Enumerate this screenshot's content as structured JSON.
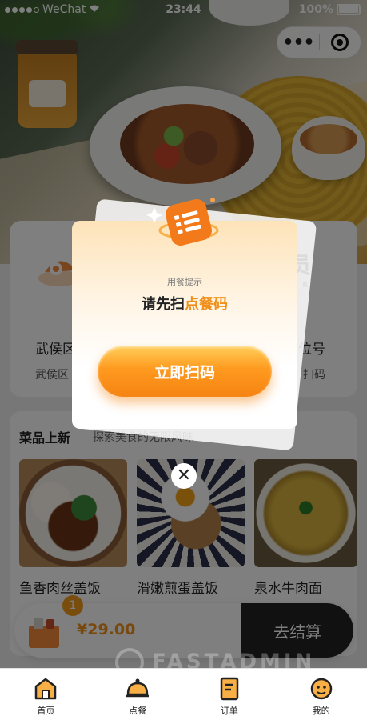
{
  "status_bar": {
    "carrier": "WeChat",
    "time": "23:44",
    "battery": "100%"
  },
  "capsule": {
    "more_label": "•••"
  },
  "store_card": {
    "store_name": "武侯区",
    "store_sub": "武侯区",
    "vip_title": "员",
    "vip_sub": "R",
    "seat_label": "桌位号",
    "scan_label": "扫码"
  },
  "new_dishes": {
    "title": "菜品上新",
    "subtitle": "探索美食的无限风味",
    "items": [
      {
        "name": "鱼香肉丝盖饭"
      },
      {
        "name": "滑嫩煎蛋盖饭"
      },
      {
        "name": "泉水牛肉面"
      }
    ]
  },
  "cart": {
    "badge": "1",
    "price": "¥29.00",
    "checkout_label": "去结算"
  },
  "modal": {
    "hint": "用餐提示",
    "title_prefix": "请先扫",
    "title_highlight": "点餐码",
    "button_label": "立即扫码",
    "close_label": "✕"
  },
  "watermark": "FASTADMIN",
  "tabbar": {
    "items": [
      {
        "label": "首页",
        "icon": "home-icon"
      },
      {
        "label": "点餐",
        "icon": "cloche-icon"
      },
      {
        "label": "订单",
        "icon": "order-icon"
      },
      {
        "label": "我的",
        "icon": "profile-icon"
      }
    ]
  },
  "colors": {
    "accent": "#f0901b",
    "dark": "#222222"
  }
}
